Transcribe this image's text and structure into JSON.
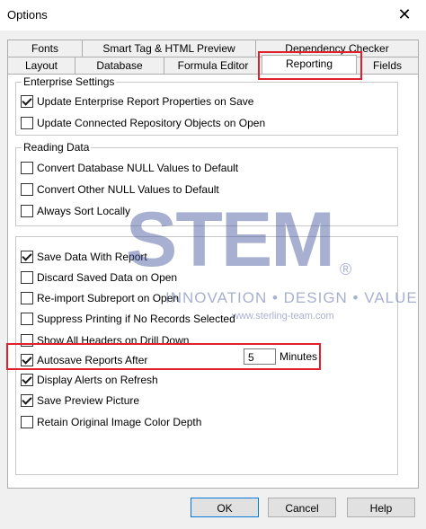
{
  "window": {
    "title": "Options",
    "close_glyph": "✕"
  },
  "tabs_top": [
    "Fonts",
    "Smart Tag & HTML Preview",
    "Dependency Checker"
  ],
  "tabs_bottom": [
    "Layout",
    "Database",
    "Formula Editor",
    "Reporting",
    "Fields"
  ],
  "active_tab": "Reporting",
  "groups": {
    "enterprise": {
      "title": "Enterprise Settings",
      "items": [
        {
          "label": "Update Enterprise Report Properties on Save",
          "checked": true
        },
        {
          "label": "Update Connected Repository Objects on Open",
          "checked": false
        }
      ]
    },
    "reading": {
      "title": "Reading Data",
      "items": [
        {
          "label": "Convert Database NULL Values to Default",
          "checked": false
        },
        {
          "label": "Convert Other NULL Values to Default",
          "checked": false
        },
        {
          "label": "Always Sort Locally",
          "checked": false
        }
      ]
    },
    "general": {
      "items": [
        {
          "label": "Save Data With Report",
          "checked": true
        },
        {
          "label": "Discard Saved Data on Open",
          "checked": false
        },
        {
          "label": "Re-import Subreport on Open",
          "checked": false
        },
        {
          "label": "Suppress Printing if No Records Selected",
          "checked": false
        },
        {
          "label": "Show All Headers on Drill Down",
          "checked": false
        },
        {
          "label": "Autosave Reports After",
          "checked": true
        },
        {
          "label": "Display Alerts on Refresh",
          "checked": true
        },
        {
          "label": "Save Preview Picture",
          "checked": true
        },
        {
          "label": "Retain Original Image Color Depth",
          "checked": false
        }
      ]
    }
  },
  "autosave": {
    "value": "5",
    "unit": "Minutes"
  },
  "buttons": {
    "ok": "OK",
    "cancel": "Cancel",
    "help": "Help"
  },
  "watermark": {
    "logo": "STEM",
    "registered": "®",
    "tagline": "INNOVATION • DESIGN • VALUE",
    "url": "www.sterling-team.com"
  },
  "highlight_color": "#e0212b"
}
